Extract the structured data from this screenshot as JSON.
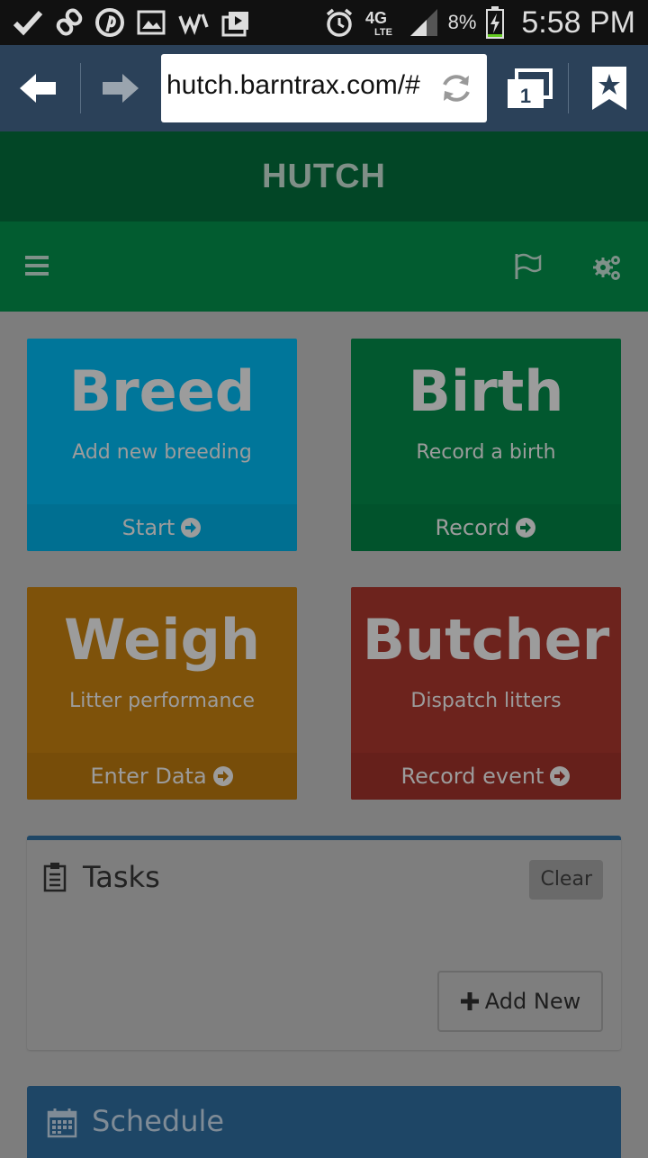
{
  "status_bar": {
    "battery_percent": "8%",
    "network": "4G LTE",
    "time": "5:58 PM",
    "icons": [
      "check-icon",
      "link-icon",
      "pinterest-icon",
      "image-icon",
      "wifi-calling-icon",
      "media-icon",
      "alarm-icon",
      "lte-icon",
      "signal-icon",
      "battery-charging-icon"
    ]
  },
  "browser": {
    "url": "hutch.barntrax.com/#",
    "tab_count": "1"
  },
  "app": {
    "title": "HUTCH"
  },
  "tiles": {
    "breed": {
      "title": "Breed",
      "subtitle": "Add new breeding",
      "action": "Start",
      "color": "#00769a"
    },
    "birth": {
      "title": "Birth",
      "subtitle": "Record a birth",
      "action": "Record",
      "color": "#02582f"
    },
    "weigh": {
      "title": "Weigh",
      "subtitle": "Litter performance",
      "action": "Enter Data",
      "color": "#7e520a"
    },
    "butcher": {
      "title": "Butcher",
      "subtitle": "Dispatch litters",
      "action": "Record event",
      "color": "#6d231d"
    }
  },
  "tasks": {
    "title": "Tasks",
    "clear_label": "Clear",
    "add_new_label": "Add New"
  },
  "schedule": {
    "title": "Schedule"
  }
}
